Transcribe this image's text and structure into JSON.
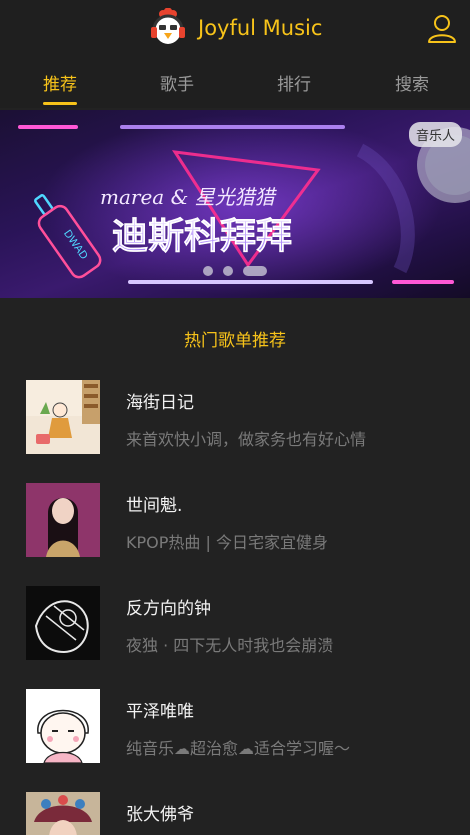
{
  "header": {
    "app_title": "Joyful Music",
    "logo_icon": "chicken-headphones-logo",
    "user_icon": "user-icon"
  },
  "tabs": [
    {
      "label": "推荐",
      "active": true
    },
    {
      "label": "歌手",
      "active": false
    },
    {
      "label": "排行",
      "active": false
    },
    {
      "label": "搜索",
      "active": false
    }
  ],
  "banner": {
    "tag": "音乐人",
    "line1": "marea & 星光猎猎",
    "line2": "迪斯科拜拜",
    "bottle_text": "DWAD",
    "slide_count": 3,
    "active_slide": 3
  },
  "section": {
    "title": "热门歌单推荐"
  },
  "playlists": [
    {
      "name": "海街日记",
      "desc": "来首欢快小调，做家务也有好心情"
    },
    {
      "name": "世间魁.",
      "desc": "KPOP热曲 | 今日宅家宜健身"
    },
    {
      "name": "反方向的钟",
      "desc": "夜独 · 四下无人时我也会崩溃"
    },
    {
      "name": "平泽唯唯",
      "desc": "纯音乐☁超治愈☁适合学习喔～"
    },
    {
      "name": "张大佛爷",
      "desc": ""
    }
  ],
  "colors": {
    "accent": "#f7c31a",
    "background": "#222222",
    "header_bg": "#1f1f1f",
    "text_primary": "#f2f2f2",
    "text_secondary": "#7a7a7a",
    "tab_inactive": "#9a9a9a"
  }
}
